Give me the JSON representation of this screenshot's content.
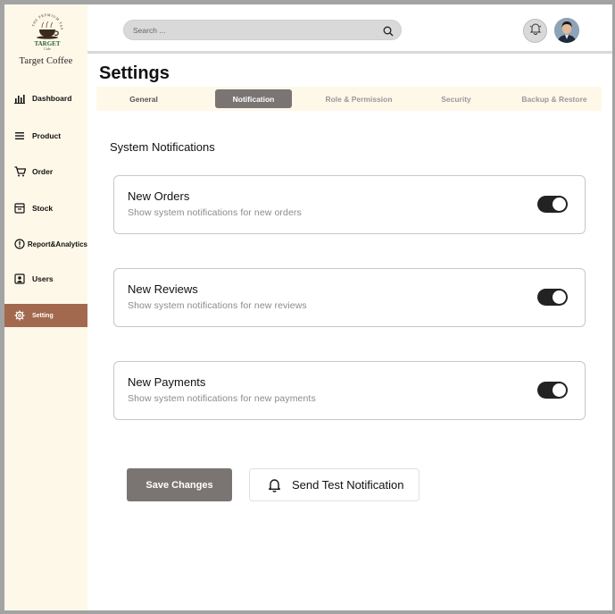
{
  "app": {
    "brand_name": "Target Coffee",
    "logo": {
      "top_text": "THE PREMIUM TASTE",
      "main_text": "TARGET",
      "sub_text": "Cafe"
    }
  },
  "sidebar": {
    "items": [
      {
        "label": "Dashboard",
        "icon": "bar-chart-icon",
        "active": false
      },
      {
        "label": "Product",
        "icon": "menu-lines-icon",
        "active": false
      },
      {
        "label": "Order",
        "icon": "cart-icon",
        "active": false
      },
      {
        "label": "Stock",
        "icon": "archive-box-icon",
        "active": false
      },
      {
        "label": "Report&Analytics",
        "icon": "info-circle-icon",
        "active": false
      },
      {
        "label": "Users",
        "icon": "user-card-icon",
        "active": false
      },
      {
        "label": "Setting",
        "icon": "gear-icon",
        "active": true
      }
    ],
    "active_color": "#a2694e",
    "background": "#fef8e9"
  },
  "header": {
    "search": {
      "placeholder": "Search ...",
      "value": "",
      "icon": "search-icon"
    },
    "notification_icon": "bell-icon",
    "avatar": "user-avatar"
  },
  "page": {
    "title": "Settings",
    "tabs": [
      {
        "label": "General",
        "active": false
      },
      {
        "label": "Notification",
        "active": true
      },
      {
        "label": "Role & Permission",
        "active": false
      },
      {
        "label": "Security",
        "active": false
      },
      {
        "label": "Backup & Restore",
        "active": false
      }
    ]
  },
  "notifications": {
    "section_title": "System Notifications",
    "items": [
      {
        "title": "New Orders",
        "description": "Show system notifications for new orders",
        "enabled": true
      },
      {
        "title": "New Reviews",
        "description": "Show system notifications for new reviews",
        "enabled": true
      },
      {
        "title": "New Payments",
        "description": "Show system notifications for new payments",
        "enabled": true
      }
    ]
  },
  "actions": {
    "save_label": "Save Changes",
    "test_label": "Send Test Notification",
    "test_icon": "bell-icon"
  }
}
